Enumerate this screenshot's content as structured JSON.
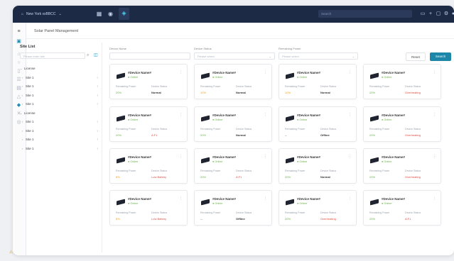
{
  "topbar": {
    "workspace": "New York xxBBCC",
    "search_placeholder": "Search",
    "icons_left": [
      "grid-icon",
      "globe-icon",
      "dashboard-icon"
    ],
    "icons_right": [
      "monitor-icon",
      "plus-icon",
      "window-icon",
      "gear-icon",
      "bell-icon"
    ]
  },
  "sidebar": {
    "icons": [
      "menu-icon",
      "solar-panel-icon",
      "home-icon",
      "circle-icon",
      "battery-icon",
      "list-icon",
      "chart-icon",
      "alert-icon",
      "map-icon",
      "tools-icon",
      "settings-icon"
    ],
    "active_index": 1
  },
  "page": {
    "title": "Solar Panel Management"
  },
  "site_list": {
    "title": "Site List",
    "search_placeholder": "Please enter site",
    "tree": [
      {
        "label": "License",
        "level": 0,
        "expanded": true
      },
      {
        "label": "Site 1",
        "level": 1
      },
      {
        "label": "Site 1",
        "level": 1
      },
      {
        "label": "Site 1",
        "level": 1
      },
      {
        "label": "Site 1",
        "level": 1
      },
      {
        "label": "License",
        "level": 0,
        "expanded": true
      },
      {
        "label": "Site 1",
        "level": 1
      },
      {
        "label": "Site 1",
        "level": 1
      },
      {
        "label": "Site 1",
        "level": 1
      },
      {
        "label": "Site 1",
        "level": 1
      }
    ]
  },
  "filters": {
    "device_name_label": "Device Name",
    "device_name_placeholder": "",
    "device_status_label": "Device Status",
    "device_status_placeholder": "Please select",
    "remaining_power_label": "Remaining Power",
    "remaining_power_placeholder": "Please select",
    "reset_label": "Reset",
    "search_label": "Search"
  },
  "card_labels": {
    "remaining_power": "Remaining Power",
    "device_status": "Device Status",
    "online": "Online"
  },
  "cards": [
    {
      "name": "#Device Name#",
      "power": "20%",
      "power_state": "ok",
      "status": "Normal",
      "status_state": "dark"
    },
    {
      "name": "#Device Name#",
      "power": "10%",
      "power_state": "warn",
      "status": "Normal",
      "status_state": "dark"
    },
    {
      "name": "#Device Name#",
      "power": "10%",
      "power_state": "warn",
      "status": "Normal",
      "status_state": "dark"
    },
    {
      "name": "#Device Name#",
      "power": "20%",
      "power_state": "ok",
      "status": "Overheating",
      "status_state": "alert"
    },
    {
      "name": "#Device Name#",
      "power": "20%",
      "power_state": "ok",
      "status": "A:F1",
      "status_state": "alert"
    },
    {
      "name": "#Device Name#",
      "power": "20%",
      "power_state": "ok",
      "status": "Normal",
      "status_state": "dark"
    },
    {
      "name": "#Device Name#",
      "power": "--",
      "power_state": "dark",
      "status": "Offline",
      "status_state": "dark"
    },
    {
      "name": "#Device Name#",
      "power": "20%",
      "power_state": "ok",
      "status": "Overheating",
      "status_state": "alert"
    },
    {
      "name": "#Device Name#",
      "power": "8%",
      "power_state": "warn",
      "status": "Low Battery",
      "status_state": "alert"
    },
    {
      "name": "#Device Name#",
      "power": "20%",
      "power_state": "ok",
      "status": "A:F1",
      "status_state": "alert"
    },
    {
      "name": "#Device Name#",
      "power": "20%",
      "power_state": "ok",
      "status": "Normal",
      "status_state": "dark"
    },
    {
      "name": "#Device Name#",
      "power": "20%",
      "power_state": "ok",
      "status": "Overheating",
      "status_state": "alert"
    },
    {
      "name": "#Device Name#",
      "power": "8%",
      "power_state": "warn",
      "status": "Low Battery",
      "status_state": "alert"
    },
    {
      "name": "#Device Name#",
      "power": "--",
      "power_state": "dark",
      "status": "Offline",
      "status_state": "dark"
    },
    {
      "name": "#Device Name#",
      "power": "20%",
      "power_state": "ok",
      "status": "Overheating",
      "status_state": "alert"
    },
    {
      "name": "#Device Name#",
      "power": "20%",
      "power_state": "ok",
      "status": "A:F1",
      "status_state": "alert"
    }
  ],
  "colors": {
    "topbar": "#1d2a45",
    "accent": "#1c87a8",
    "online": "#6ab04c",
    "alert": "#e24b40",
    "warn": "#f0a020"
  }
}
